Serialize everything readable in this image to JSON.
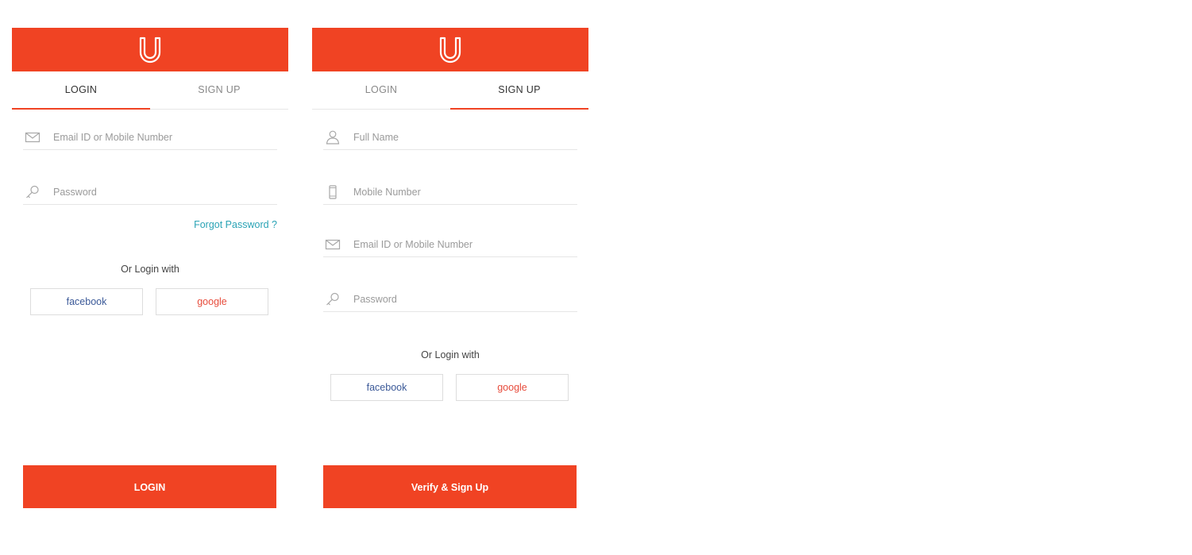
{
  "brand": {
    "color": "#f04323",
    "logo_icon": "u-logo-icon"
  },
  "login_screen": {
    "tabs": {
      "login": "LOGIN",
      "signup": "SIGN UP",
      "active": "login"
    },
    "email_placeholder": "Email ID or Mobile Number",
    "password_placeholder": "Password",
    "forgot_password": "Forgot Password ?",
    "or_login_with": "Or Login with",
    "facebook": "facebook",
    "google": "google",
    "submit": "LOGIN"
  },
  "signup_screen": {
    "tabs": {
      "login": "LOGIN",
      "signup": "SIGN UP",
      "active": "signup"
    },
    "fullname_placeholder": "Full Name",
    "mobile_placeholder": "Mobile Number",
    "email_placeholder": "Email ID or Mobile Number",
    "password_placeholder": "Password",
    "or_login_with": "Or Login with",
    "facebook": "facebook",
    "google": "google",
    "submit": "Verify & Sign Up"
  },
  "icons": {
    "email": "mail-icon",
    "password": "key-icon",
    "fullname": "user-icon",
    "mobile": "phone-icon"
  },
  "colors": {
    "accent": "#f04323",
    "link": "#2aa3b5",
    "facebook": "#3b5998",
    "google": "#e74c3c"
  }
}
